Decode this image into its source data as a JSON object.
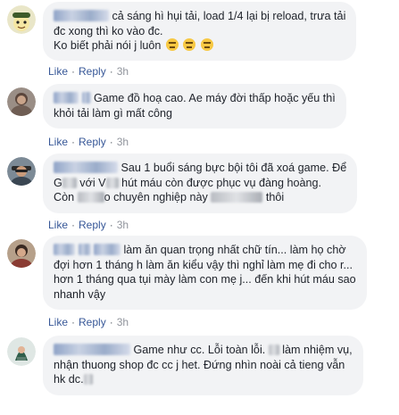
{
  "actions": {
    "like": "Like",
    "reply": "Reply",
    "separator": "·"
  },
  "comments": [
    {
      "line1": "cả sáng hì hụi tải, load 1/4 lại bị reload, trưa tải",
      "line2": "đc xong thì ko vào đc.",
      "line3": "Ko biết phải nói j luôn",
      "emoji": [
        "expressionless-face",
        "expressionless-face",
        "expressionless-face"
      ],
      "time": "3h"
    },
    {
      "line1": "Game đồ hoạ cao. Ae máy đời thấp hoặc yếu thì",
      "line2": "khỏi tải làm gì mất công",
      "time": "3h"
    },
    {
      "line1": "Sau 1 buổi sáng bực bội tôi đã xoá game. Để",
      "line2a": "G",
      "line2b": "với V",
      "line2c": "hút máu còn được phục vụ đàng hoàng.",
      "line3a": "Còn",
      "line3b": "o chuyên nghiệp này",
      "line3c": "thôi",
      "time": "3h"
    },
    {
      "line1": "làm ăn quan trọng nhất chữ tín... làm họ chờ",
      "line2": "đợi hơn 1 tháng h làm ăn kiểu vậy thì nghỉ làm mẹ đi cho r...",
      "line3": "hơn 1 tháng qua tụi mày làm con mẹ j... đến khi hút máu sao",
      "line4": "nhanh vậy",
      "time": "3h"
    },
    {
      "line1": "Game như cc. Lỗi toàn lỗi.",
      "line1b": "làm nhiệm vụ,",
      "line2": "nhận thuong shop đc cc j het. Đứng nhìn noài cả tieng vẫn",
      "line3": "hk dc.",
      "time": ""
    }
  ]
}
